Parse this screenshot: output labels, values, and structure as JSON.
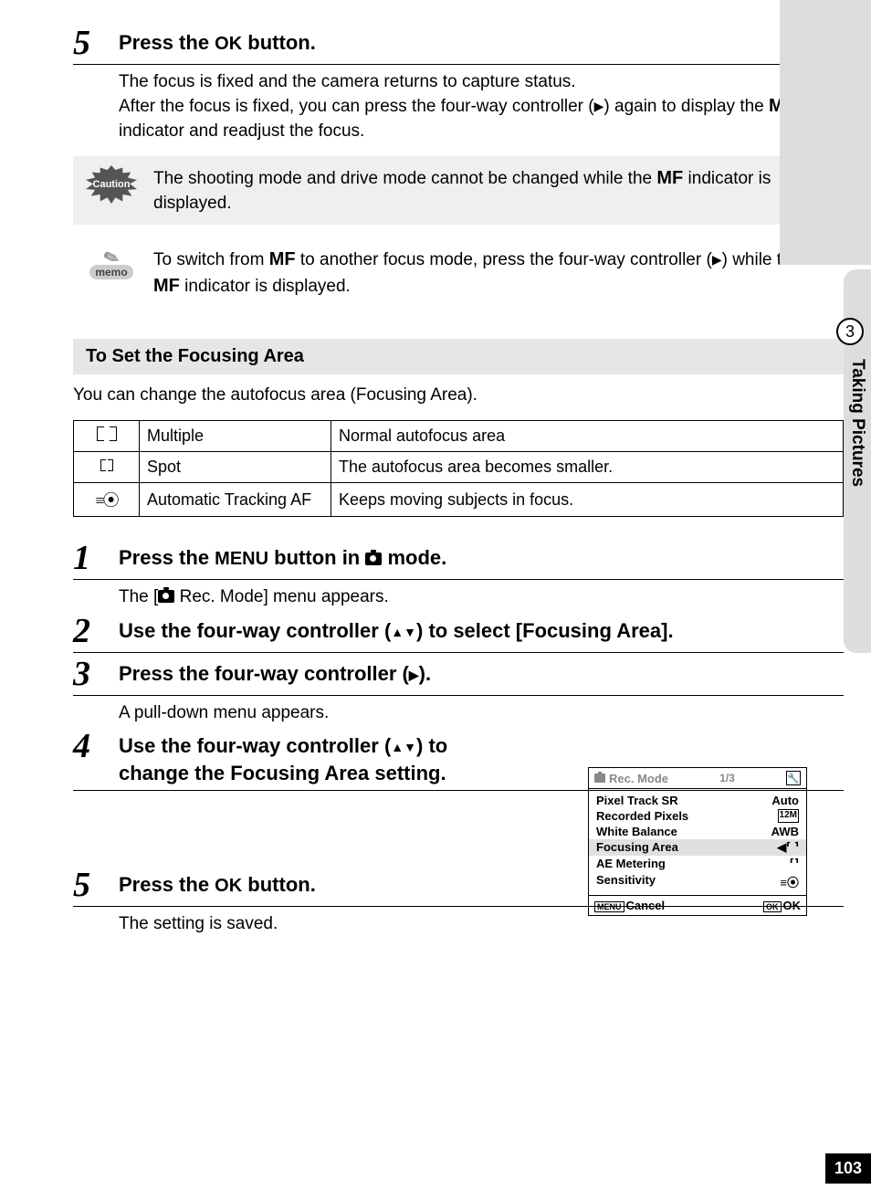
{
  "side": {
    "chapter_num": "3",
    "chapter_title": "Taking Pictures"
  },
  "page_number": "103",
  "step5a": {
    "num": "5",
    "title_pre": "Press the ",
    "title_bold": "OK",
    "title_post": " button.",
    "body1": "The focus is fixed and the camera returns to capture status.",
    "body2_pre": "After the focus is fixed, you can press the four-way controller (",
    "body2_glyph": "▶",
    "body2_mid": ") again to display the ",
    "body2_bold": "MF",
    "body2_post": " indicator and readjust the focus."
  },
  "caution": {
    "label": "Caution",
    "text_pre": "The shooting mode and drive mode cannot be changed while the ",
    "text_bold": "MF",
    "text_post": " indicator is displayed."
  },
  "memo": {
    "label": "memo",
    "text_pre": "To switch from ",
    "text_bold1": "MF",
    "text_mid1": " to another focus mode, press the four-way controller (",
    "text_glyph": "▶",
    "text_mid2": ") while the ",
    "text_bold2": "MF",
    "text_post": " indicator is displayed."
  },
  "section_title": "To Set the Focusing Area",
  "section_intro": "You can change the autofocus area (Focusing Area).",
  "af_table": [
    {
      "name": "Multiple",
      "desc": "Normal autofocus area"
    },
    {
      "name": "Spot",
      "desc": "The autofocus area becomes smaller."
    },
    {
      "name": "Automatic Tracking AF",
      "desc": "Keeps moving subjects in focus."
    }
  ],
  "steps": {
    "s1": {
      "num": "1",
      "title_pre": "Press the ",
      "title_bold": "MENU",
      "title_mid": " button in ",
      "title_post": " mode.",
      "body_pre": "The [",
      "body_post": " Rec. Mode] menu appears."
    },
    "s2": {
      "num": "2",
      "title_pre": "Use the four-way controller (",
      "title_glyph": "▲▼",
      "title_post": ") to select [Focusing Area]."
    },
    "s3": {
      "num": "3",
      "title_pre": "Press the four-way controller (",
      "title_glyph": "▶",
      "title_post": ").",
      "body": "A pull-down menu appears."
    },
    "s4": {
      "num": "4",
      "title_pre": "Use the four-way controller (",
      "title_glyph": "▲▼",
      "title_post": ") to change the Focusing Area setting."
    },
    "s5": {
      "num": "5",
      "title_pre": "Press the ",
      "title_bold": "OK",
      "title_post": " button.",
      "body": "The setting is saved."
    }
  },
  "screen": {
    "header_title": "Rec. Mode",
    "header_page": "1/3",
    "tool_glyph": "🔧",
    "rows": [
      {
        "label": "Pixel Track SR",
        "value": "Auto"
      },
      {
        "label": "Recorded Pixels",
        "value": "12M"
      },
      {
        "label": "White Balance",
        "value": "AWB"
      },
      {
        "label": "Focusing Area",
        "value": "⸢ ⸣"
      },
      {
        "label": "AE Metering",
        "value": "⸢⸣"
      },
      {
        "label": "Sensitivity",
        "value": "≡⦿"
      }
    ],
    "footer_left_btn": "MENU",
    "footer_left": "Cancel",
    "footer_right_btn": "OK",
    "footer_right": "OK"
  }
}
